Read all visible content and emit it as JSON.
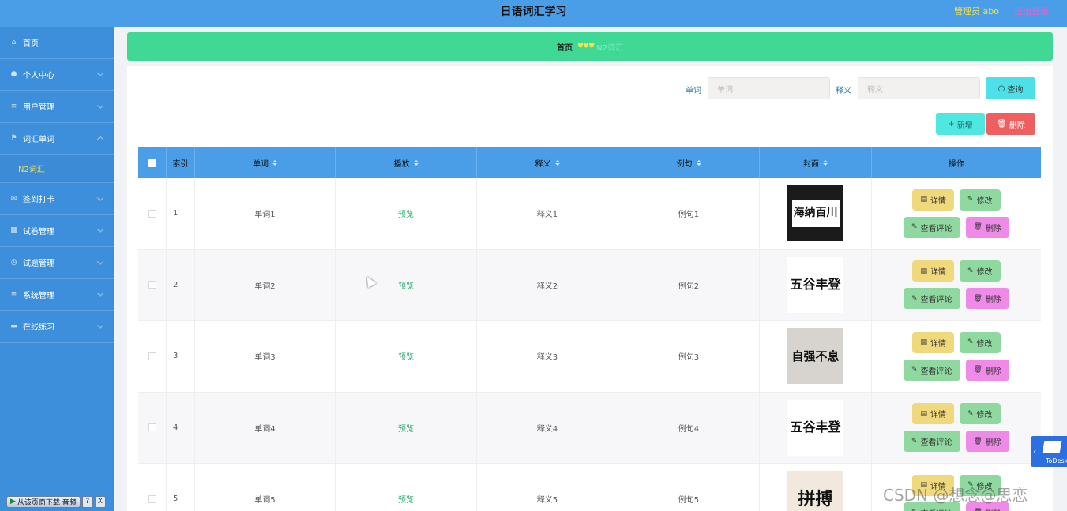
{
  "header": {
    "title": "日语词汇学习",
    "admin_label": "管理员 abo",
    "logout_label": "退出登录"
  },
  "sidebar": {
    "items": [
      {
        "label": "首页",
        "icon": "home-icon",
        "glyph": "⌂"
      },
      {
        "label": "个人中心",
        "icon": "user-icon",
        "glyph": "●"
      },
      {
        "label": "用户管理",
        "icon": "list-icon",
        "glyph": "≡"
      },
      {
        "label": "词汇单词",
        "icon": "flag-icon",
        "glyph": "⚑"
      },
      {
        "label": "签到打卡",
        "icon": "mail-icon",
        "glyph": "✉"
      },
      {
        "label": "试卷管理",
        "icon": "grid-icon",
        "glyph": "▦"
      },
      {
        "label": "试题管理",
        "icon": "clock-icon",
        "glyph": "◷"
      },
      {
        "label": "系统管理",
        "icon": "menu-icon",
        "glyph": "≡"
      },
      {
        "label": "在线练习",
        "icon": "comment-icon",
        "glyph": "▬"
      }
    ],
    "sub_item": "N2词汇"
  },
  "breadcrumb": {
    "home": "首页",
    "hearts": "♥♥♥",
    "current": "N2词汇"
  },
  "search": {
    "word_label": "单词",
    "word_placeholder": "单词",
    "meaning_label": "释义",
    "meaning_placeholder": "释义",
    "query_button": "查询",
    "add_button": "新增",
    "delete_button": "删除"
  },
  "table": {
    "columns": [
      "索引",
      "单词",
      "播放",
      "释义",
      "例句",
      "封面",
      "操作"
    ],
    "rows": [
      {
        "index": "1",
        "word": "单词1",
        "play": "预览",
        "meaning": "释义1",
        "example": "例句1",
        "cover_text": "海纳百川"
      },
      {
        "index": "2",
        "word": "单词2",
        "play": "预览",
        "meaning": "释义2",
        "example": "例句2",
        "cover_text": "五谷丰登"
      },
      {
        "index": "3",
        "word": "单词3",
        "play": "预览",
        "meaning": "释义3",
        "example": "例句3",
        "cover_text": "自强不息"
      },
      {
        "index": "4",
        "word": "单词4",
        "play": "预览",
        "meaning": "释义4",
        "example": "例句4",
        "cover_text": "五谷丰登"
      },
      {
        "index": "5",
        "word": "单词5",
        "play": "预览",
        "meaning": "释义5",
        "example": "例句5",
        "cover_text": "拼搏"
      }
    ],
    "ops": {
      "detail": "详情",
      "edit": "修改",
      "review": "查看评论",
      "delete": "删除"
    }
  },
  "widgets": {
    "download_label": "从该页面下载 音频",
    "help": "?",
    "close": "X",
    "todesk": "ToDesk",
    "watermark": "CSDN @想念@思恋"
  }
}
